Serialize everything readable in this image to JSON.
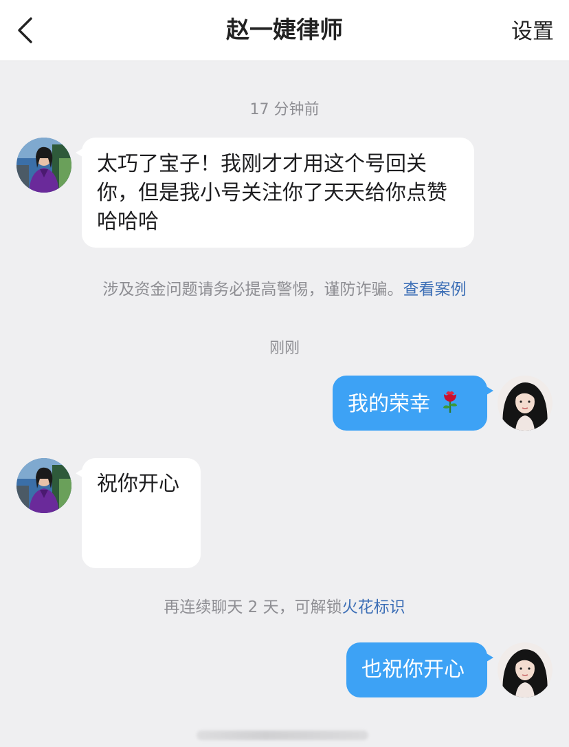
{
  "header": {
    "title": "赵一婕律师",
    "settings_label": "设置",
    "back_icon": "chevron-left-icon"
  },
  "messages": [
    {
      "side": "left",
      "text": "太巧了宝子！我刚才才用这个号回关你，但是我小号关注你了天天给你点赞哈哈哈"
    },
    {
      "side": "right",
      "text": "我的荣幸",
      "emoji": "rose-icon"
    },
    {
      "side": "left",
      "text": "祝你开心"
    },
    {
      "side": "right",
      "text": "也祝你开心"
    }
  ],
  "timestamps": {
    "first": "17 分钟前",
    "second": "刚刚"
  },
  "notices": {
    "scam_warning": "涉及资金问题请务必提高警惕，谨防诈骗。",
    "scam_link": "查看案例",
    "streak_text": "再连续聊天 2 天，可解锁",
    "streak_link": "火花标识"
  },
  "colors": {
    "background": "#efeff1",
    "outgoing_bubble": "#3da2f5",
    "incoming_bubble": "#ffffff",
    "link": "#3d6fb6",
    "meta_text": "#8e8e93"
  }
}
